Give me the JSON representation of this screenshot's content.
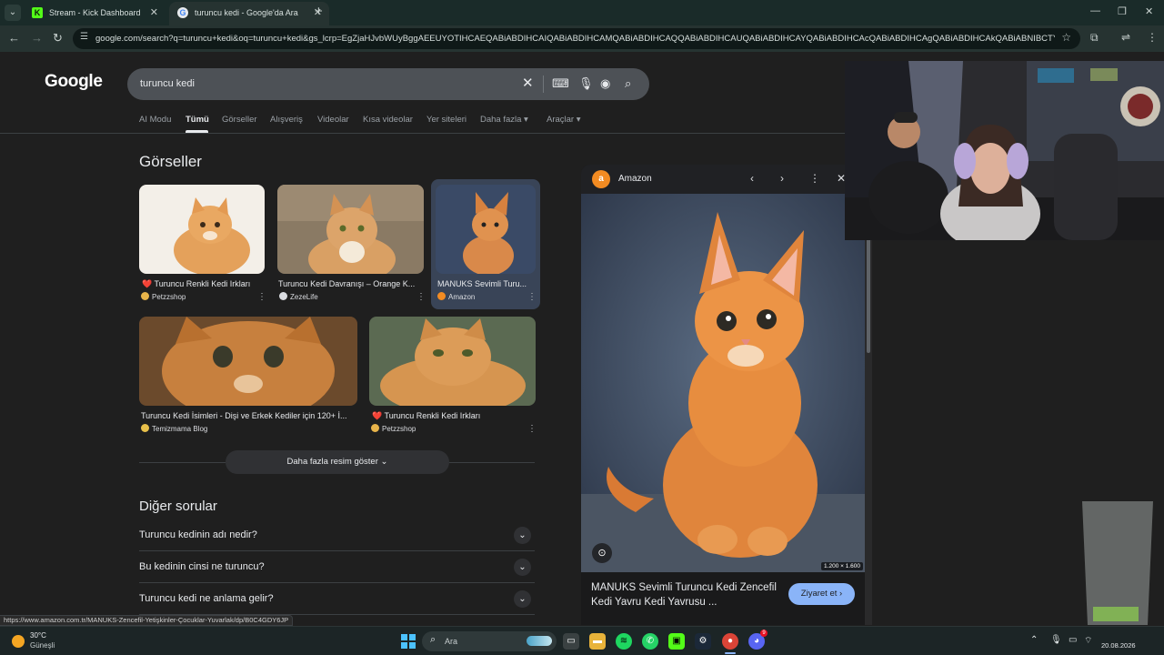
{
  "browser": {
    "tabs": [
      {
        "title": "Stream - Kick Dashboard",
        "favicon": "kick-icon"
      },
      {
        "title": "turuncu kedi - Google'da Ara",
        "favicon": "google-icon",
        "active": true
      }
    ],
    "url": "google.com/search?q=turuncu+kedi&oq=turuncu+kedi&gs_lcrp=EgZjaHJvbWUyBggAEEUYOTIHCAEQABiABDIHCAIQABiABDIHCAMQABiABDIHCAQQABiABDIHCAUQABiABDIHCAYQABiABDIHCAcQABiABDIHCAgQABiABDIHCAkQABiABNIBCTYwNjdqMGo..."
  },
  "google": {
    "logo": "Google",
    "query": "turuncu kedi",
    "filters": [
      "AI Modu",
      "Tümü",
      "Görseller",
      "Alışveriş",
      "Videolar",
      "Kısa videolar",
      "Yer siteleri",
      "Daha fazla",
      "Araçlar"
    ],
    "active_filter": "Tümü",
    "images_heading": "Görseller",
    "images": [
      {
        "caption": "Turuncu Renkli Kedi Irkları",
        "source": "Petzzshop",
        "heart": true
      },
      {
        "caption": "Turuncu Kedi Davranışı – Orange K...",
        "source": "ZezeLife"
      },
      {
        "caption": "MANUKS Sevimli Turu...",
        "source": "Amazon",
        "selected": true
      },
      {
        "caption": "Turuncu Kedi İsimleri - Dişi ve Erkek Kediler için 120+ İ...",
        "source": "Temizmama Blog"
      },
      {
        "caption": "Turuncu Renkli Kedi Irkları",
        "source": "Petzzshop",
        "heart": true
      }
    ],
    "more_images": "Daha fazla resim göster",
    "questions_heading": "Diğer sorular",
    "questions": [
      "Turuncu kedinin adı nedir?",
      "Bu kedinin cinsi ne turuncu?",
      "Turuncu kedi ne anlama gelir?"
    ]
  },
  "preview": {
    "source": "Amazon",
    "dimensions": "1.200 × 1.600",
    "title": "MANUKS Sevimli Turuncu Kedi Zencefil Kedi Yavru Kedi Yavrusu ...",
    "visit": "Ziyaret et"
  },
  "status_url": "https://www.amazon.com.tr/MANUKS-Zencefil-Yetişkinler-Çocuklar-Yuvarlak/dp/B0C4GDY6JP",
  "taskbar": {
    "temp": "30°C",
    "condition": "Güneşli",
    "search": "Ara",
    "discord_badge": "9",
    "date": "20.08.2026"
  },
  "colors": {
    "accent": "#8ab4f8",
    "kick": "#53fc18",
    "amazon": "#f28b22"
  }
}
